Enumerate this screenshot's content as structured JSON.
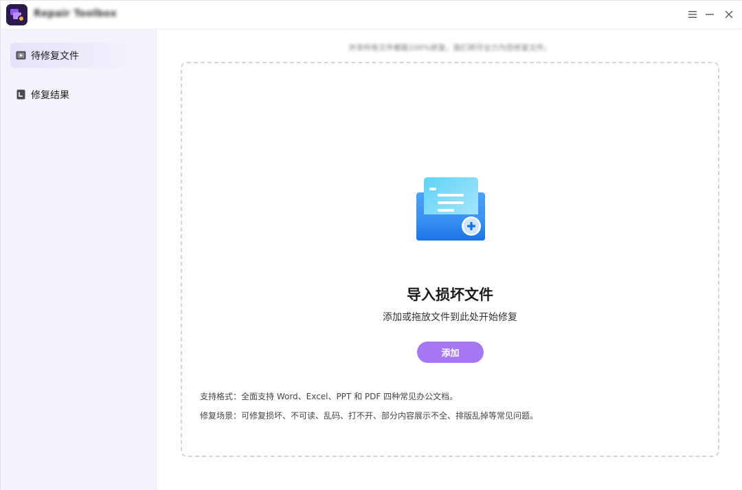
{
  "app": {
    "title": "Repair Toolbox",
    "accent_color": "#a577f3",
    "logo_icon": "repair-toolbox-logo"
  },
  "window_controls": {
    "menu_icon": "hamburger-menu-icon",
    "minimize_icon": "minimize-icon",
    "close_icon": "close-icon"
  },
  "sidebar": {
    "items": [
      {
        "label": "待修复文件",
        "icon": "video-file-icon",
        "active": true
      },
      {
        "label": "修复结果",
        "icon": "result-document-icon",
        "active": false
      }
    ]
  },
  "main": {
    "notice": "并非所有文件都能100%修复，我们将尽全力为您修复文件。",
    "dropzone": {
      "illustration_icon": "add-file-folder-icon",
      "title": "导入损坏文件",
      "subtitle": "添加或拖放文件到此处开始修复",
      "add_button_label": "添加"
    },
    "info": {
      "formats": "支持格式：全面支持 Word、Excel、PPT 和 PDF 四种常见办公文档。",
      "scenarios": "修复场景：可修复损坏、不可读、乱码、打不开、部分内容展示不全、排版乱掉等常见问题。"
    }
  }
}
